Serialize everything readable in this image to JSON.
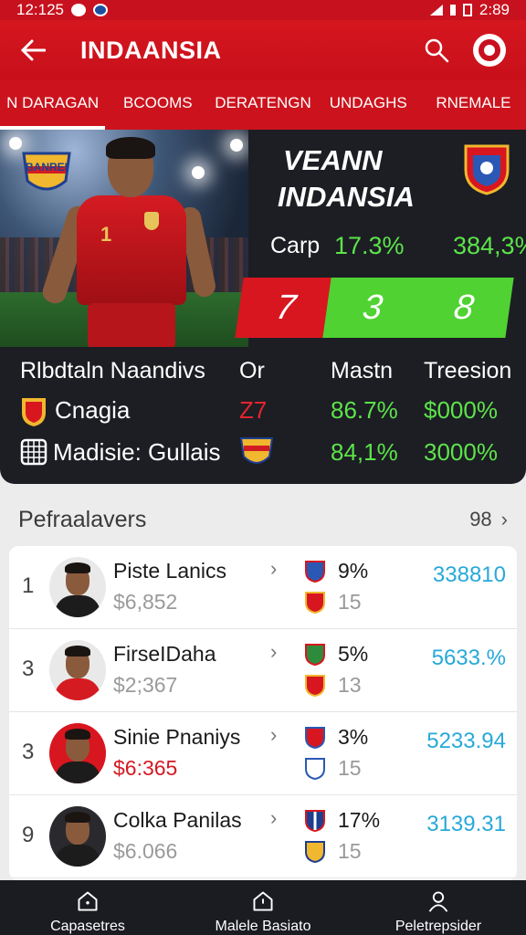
{
  "status_bar": {
    "time_left": "12:125",
    "time_right": "2:89"
  },
  "app_bar": {
    "title": "INDAANSIA"
  },
  "tabs": [
    {
      "label": "N DARAGAN",
      "active": true
    },
    {
      "label": "BCOOMS",
      "active": false
    },
    {
      "label": "DERATENGN",
      "active": false
    },
    {
      "label": "UNDAGHS",
      "active": false
    },
    {
      "label": "RNEMALE",
      "active": false
    }
  ],
  "hero": {
    "badge_text": "BANREI",
    "title_line1": "VEANN",
    "title_line2": "INDANSIA",
    "stat_label": "Carp",
    "stat_value_1": "17.3%",
    "stat_value_2": "384,3%",
    "score_red": "7",
    "score_green_1": "3",
    "score_green_2": "8",
    "table_head": {
      "col1": "Rlbdtaln Naandivs",
      "col2": "Or",
      "col3": "Mastn",
      "col4": "Treesion"
    },
    "rows": [
      {
        "name": "Cnagia",
        "col2": "Z7",
        "col3": "86.7%",
        "col4": "$000%"
      },
      {
        "name": "Madisie: Gullais",
        "col2": "",
        "col3": "84,1%",
        "col4": "3000%"
      }
    ]
  },
  "section": {
    "title": "Pefraalavers",
    "count": "98"
  },
  "players": [
    {
      "rank": "1",
      "name": "Piste Lanics",
      "price": "$6,852",
      "price_red": false,
      "pct": "9%",
      "sub": "15",
      "value": "338810",
      "shirt": "#1c1c1c"
    },
    {
      "rank": "3",
      "name": "FirseIDaha",
      "price": "$2;367",
      "price_red": false,
      "pct": "5%",
      "sub": "13",
      "value": "5633.%",
      "shirt": "#d51b22"
    },
    {
      "rank": "3",
      "name": "Sinie Pnaniys",
      "price": "$6:365",
      "price_red": true,
      "pct": "3%",
      "sub": "15",
      "value": "5233.94",
      "shirt": "#1c1c1c"
    },
    {
      "rank": "9",
      "name": "Colka Panilas",
      "price": "$6.066",
      "price_red": false,
      "pct": "17%",
      "sub": "15",
      "value": "3139.31",
      "shirt": "#1c1c1c"
    }
  ],
  "bottom_nav": [
    {
      "label": "Capasetres",
      "icon": "home-icon"
    },
    {
      "label": "Malele Basiato",
      "icon": "home-icon"
    },
    {
      "label": "Peletrepsider",
      "icon": "person-icon"
    }
  ],
  "colors": {
    "brand_red": "#c8111e",
    "accent_green": "#5de34a",
    "value_blue": "#27a9d8",
    "dark_card": "#1c1e24"
  }
}
